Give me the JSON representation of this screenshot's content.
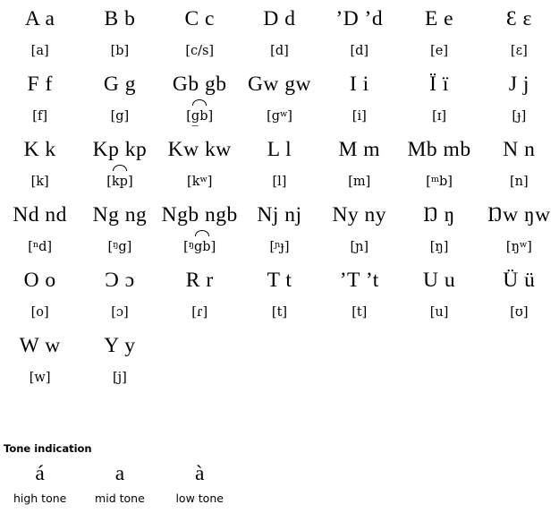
{
  "chart_data": {
    "type": "table",
    "title": "Alphabet chart with IPA pronunciation and tone indication",
    "columns": 7,
    "rows": [
      {
        "letters": [
          "A a",
          "B b",
          "C c",
          "D d",
          "’D ’d",
          "E e",
          "Ɛ ɛ"
        ],
        "ipa": [
          "[a]",
          "[b]",
          "[c/s]",
          "[d]",
          "[d]",
          "[e]",
          "[ɛ]"
        ]
      },
      {
        "letters": [
          "F f",
          "G g",
          "Gb gb",
          "Gw gw",
          "I i",
          "Ï ï",
          "J j"
        ],
        "ipa": [
          "[f]",
          "[g]",
          "[g͡b]",
          "[gʷ]",
          "[i]",
          "[ɪ]",
          "[ɟ]"
        ]
      },
      {
        "letters": [
          "K k",
          "Kp kp",
          "Kw kw",
          "L l",
          "M m",
          "Mb mb",
          "N n"
        ],
        "ipa": [
          "[k]",
          "[k͡p]",
          "[kʷ]",
          "[l]",
          "[m]",
          "[ᵐb]",
          "[n]"
        ]
      },
      {
        "letters": [
          "Nd nd",
          "Ng ng",
          "Ngb ngb",
          "Nj nj",
          "Ny ny",
          "Ŋ ŋ",
          "Ŋw ŋw"
        ],
        "ipa": [
          "[ⁿd]",
          "[ᵑg]",
          "[ᵑg͡b]",
          "[ᶠɟ]",
          "[ɲ]",
          "[ŋ]",
          "[ŋʷ]"
        ]
      },
      {
        "letters": [
          "O o",
          "Ɔ ɔ",
          "R r",
          "T t",
          "’T ’t",
          "U u",
          "Ü ü"
        ],
        "ipa": [
          "[o]",
          "[ɔ]",
          "[ɾ]",
          "[t]",
          "[t]",
          "[u]",
          "[ʊ]"
        ]
      },
      {
        "letters": [
          "W w",
          "Y y",
          "",
          "",
          "",
          "",
          ""
        ],
        "ipa": [
          "[w]",
          "[j]",
          "",
          "",
          "",
          "",
          ""
        ]
      }
    ],
    "tone": {
      "heading": "Tone indication",
      "marks": [
        "á",
        "a",
        "à"
      ],
      "labels": [
        "high tone",
        "mid tone",
        "low tone"
      ]
    }
  }
}
